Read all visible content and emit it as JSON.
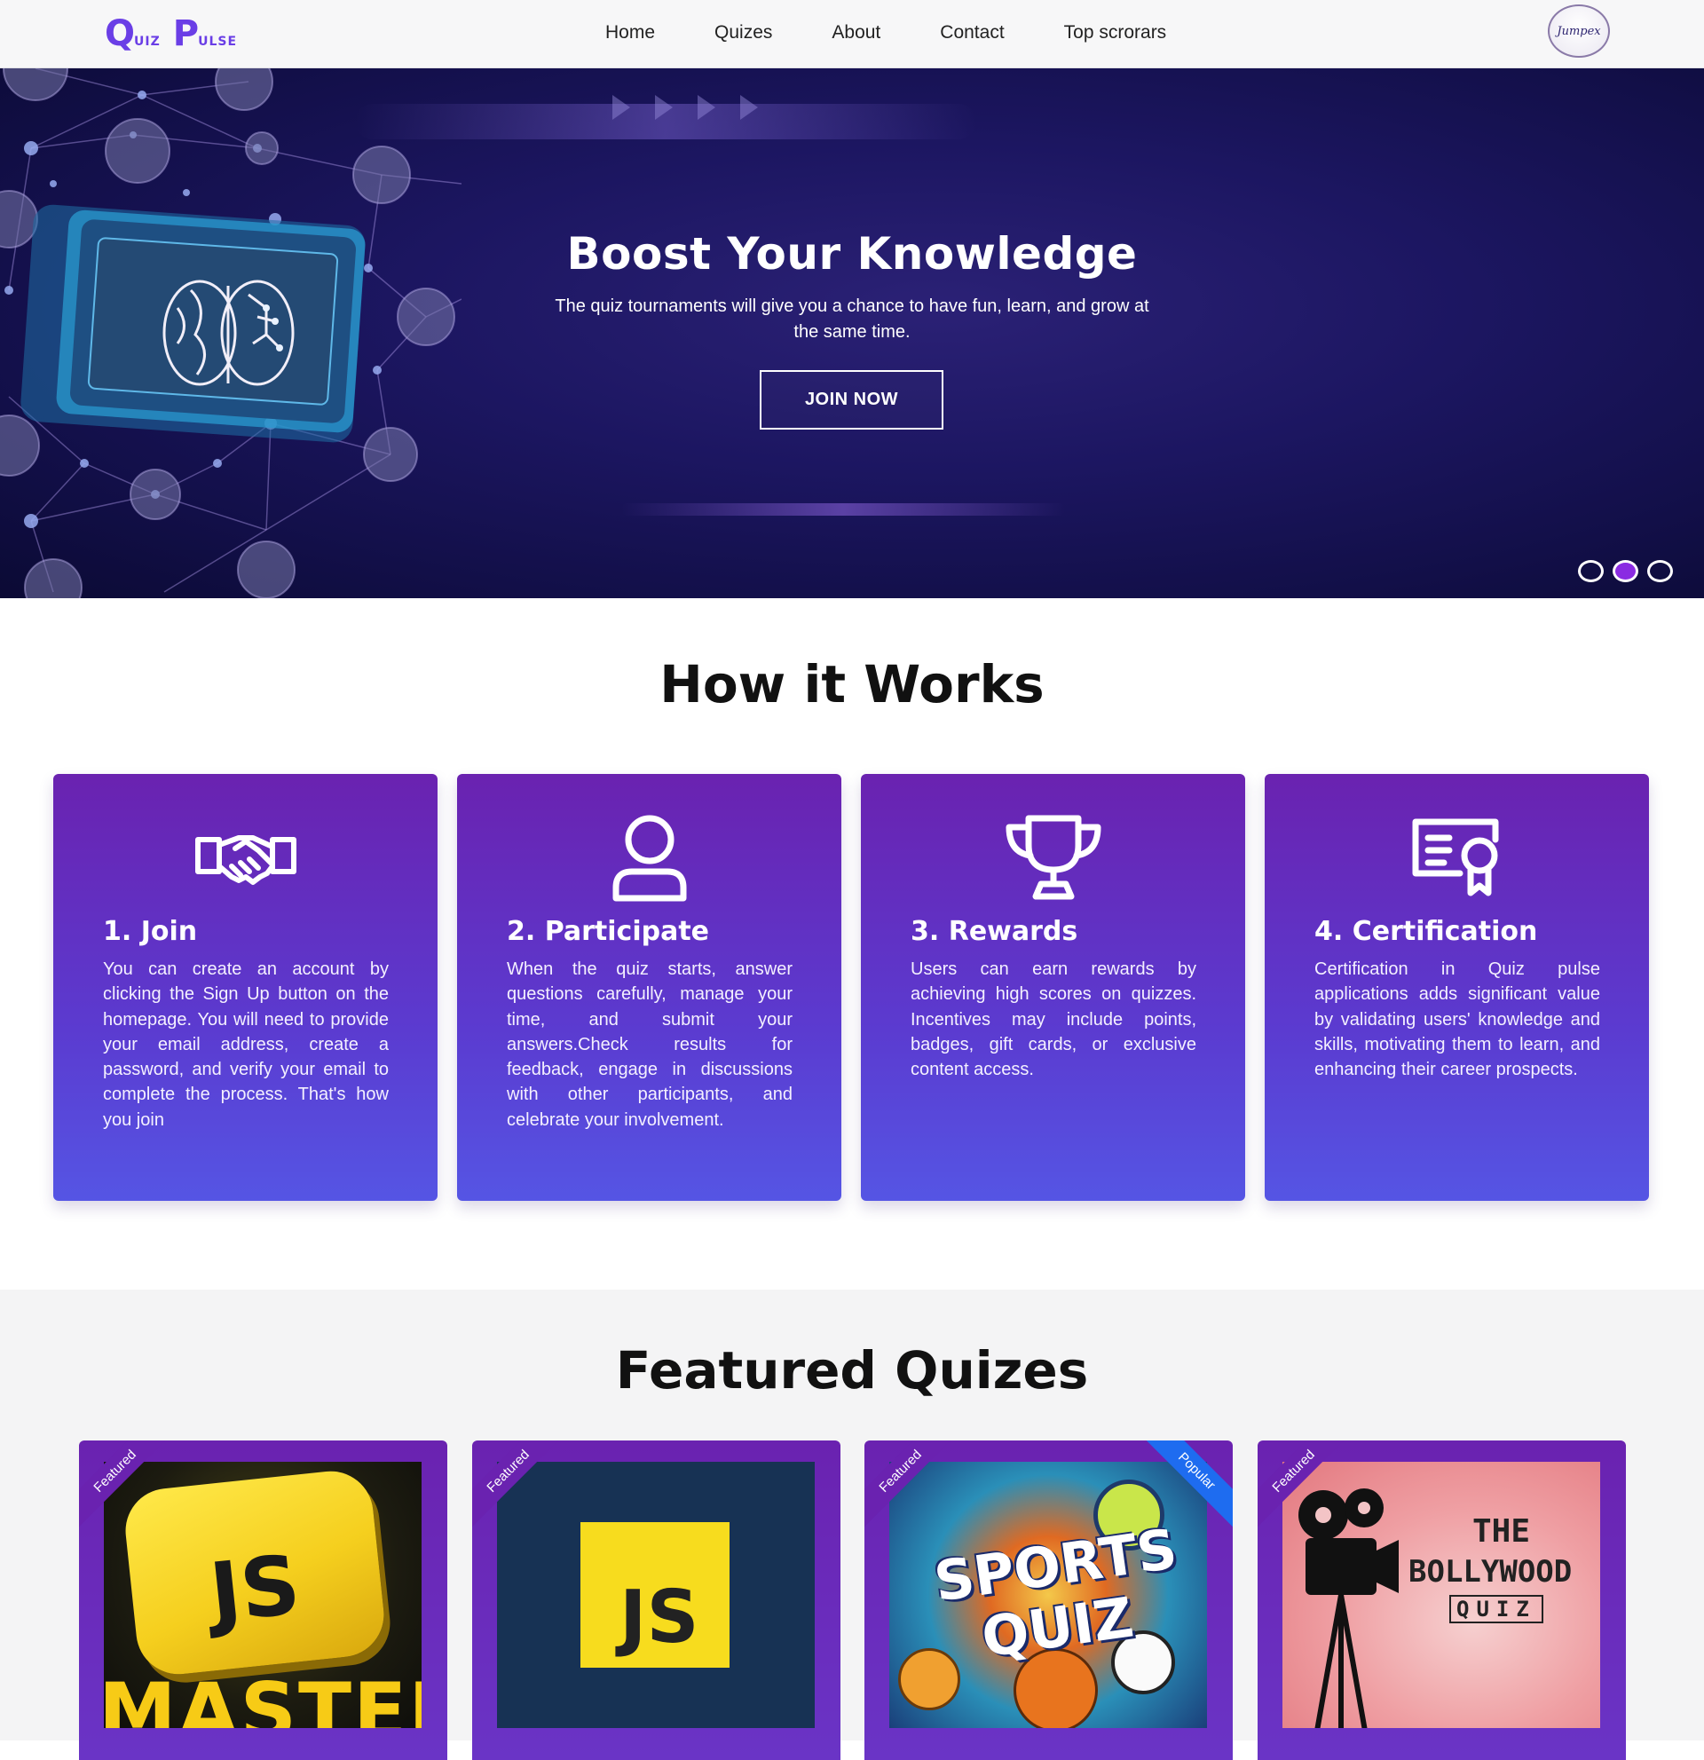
{
  "nav": {
    "logo": {
      "q": "Q",
      "uiz": "UIZ",
      "p": "P",
      "ulse": "ULSE"
    },
    "links": [
      "Home",
      "Quizes",
      "About",
      "Contact",
      "Top scrorars"
    ],
    "avatar_text": "Jumpex"
  },
  "hero": {
    "title": "Boost Your Knowledge",
    "subtitle": "The quiz tournaments will give you a chance to have fun, learn, and grow at the same time.",
    "cta": "JOIN NOW",
    "slides": 3,
    "active_slide": 2
  },
  "how": {
    "title": "How it Works",
    "cards": [
      {
        "icon": "handshake-icon",
        "title": "1. Join",
        "text": "You can create an account by clicking the Sign Up button on the homepage. You will need to provide your email address, create a password, and verify your email to complete the process. That's how you join"
      },
      {
        "icon": "user-icon",
        "title": "2. Participate",
        "text": "When the quiz starts, answer questions carefully, manage your time, and submit your answers.Check results for feedback, engage in discussions with other participants, and celebrate your involvement."
      },
      {
        "icon": "trophy-icon",
        "title": "3. Rewards",
        "text": "Users can earn rewards by achieving high scores on quizzes. Incentives may include points, badges, gift cards, or exclusive content access."
      },
      {
        "icon": "certificate-icon",
        "title": "4. Certification",
        "text": "Certification in Quiz pulse applications adds significant value by validating users' knowledge and skills, motivating them to learn, and enhancing their career prospects."
      }
    ]
  },
  "featured": {
    "title": "Featured Quizes",
    "cards": [
      {
        "ribbon": "Featured",
        "image_text": [
          "JS",
          "MASTER"
        ]
      },
      {
        "ribbon": "Featured",
        "image_text": [
          "JS"
        ]
      },
      {
        "ribbon": "Featured",
        "badge": "Popular",
        "image_text": [
          "SPORTS",
          "QUIZ"
        ]
      },
      {
        "ribbon": "Featured",
        "image_text": [
          "THE",
          "BOLLYWOOD",
          "QUIZ"
        ]
      }
    ]
  },
  "colors": {
    "brand": "#6a3ee6",
    "card_top": "#6a22b0",
    "card_bottom": "#5555e4",
    "popular": "#1e6cf0"
  }
}
